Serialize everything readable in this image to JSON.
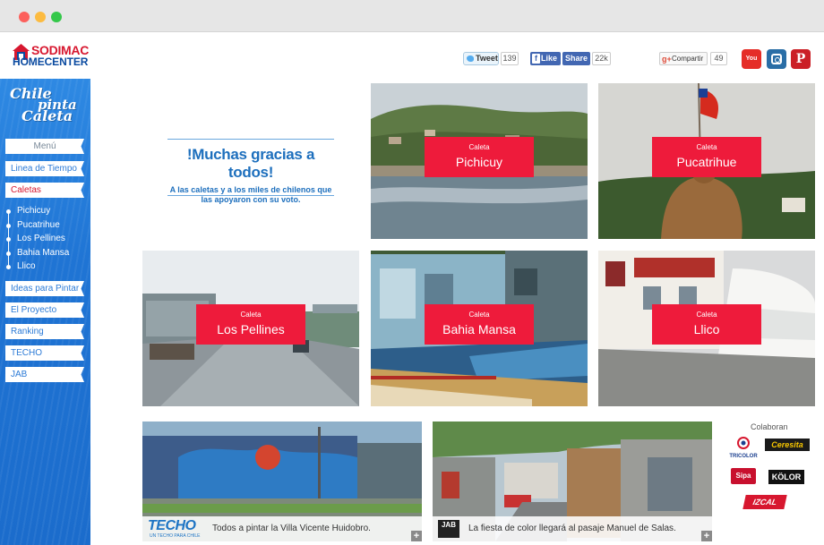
{
  "header": {
    "logo": {
      "line1": "SODIMAC",
      "line2": "HOMECENTER"
    },
    "social": {
      "tweet_label": "Tweet",
      "tweet_count": "139",
      "fb_like_label": "Like",
      "fb_share_label": "Share",
      "fb_count": "22k",
      "gplus_label": "Compartir",
      "gplus_count": "49",
      "youtube_label": "You Tube",
      "pinterest_label": "P"
    }
  },
  "sidebar": {
    "title": {
      "line1": "Chile",
      "line2": "pinta",
      "line3": "Caleta"
    },
    "menu_header": "Menú",
    "items": [
      {
        "label": "Linea de Tiempo"
      },
      {
        "label": "Caletas",
        "active": true
      },
      {
        "label": "Ideas para Pintar"
      },
      {
        "label": "El Proyecto"
      },
      {
        "label": "Ranking"
      },
      {
        "label": "TECHO"
      },
      {
        "label": "JAB"
      }
    ],
    "subitems": [
      "Pichicuy",
      "Pucatrihue",
      "Los Pellines",
      "Bahia Mansa",
      "Llico"
    ]
  },
  "thanks": {
    "headline": "!Muchas gracias a todos!",
    "body": "A las caletas y a los miles de chilenos que las apoyaron con su voto."
  },
  "caletas": [
    {
      "kind": "Caleta",
      "name": "Pichicuy"
    },
    {
      "kind": "Caleta",
      "name": "Pucatrihue"
    },
    {
      "kind": "Caleta",
      "name": "Los Pellines"
    },
    {
      "kind": "Caleta",
      "name": "Bahia Mansa"
    },
    {
      "kind": "Caleta",
      "name": "Llico"
    }
  ],
  "features": [
    {
      "logo": "TECHO",
      "logo_sub": "UN TECHO PARA CHILE",
      "caption": "Todos a pintar la Villa Vicente Huidobro.",
      "more": "+"
    },
    {
      "logo": "JAB",
      "logo_sub": "JUNTO AL BARRIO",
      "caption": "La fiesta de color llegará al pasaje Manuel de Salas.",
      "more": "+"
    }
  ],
  "collaborators": {
    "title": "Colaboran",
    "logos": [
      "TRICOLOR",
      "Ceresita",
      "Sipa",
      "KÖLOR",
      "IZCAL"
    ]
  },
  "colors": {
    "accent_red": "#ee1b3b",
    "sidebar_blue": "#1f74d4",
    "link_blue": "#1d6fbd"
  }
}
